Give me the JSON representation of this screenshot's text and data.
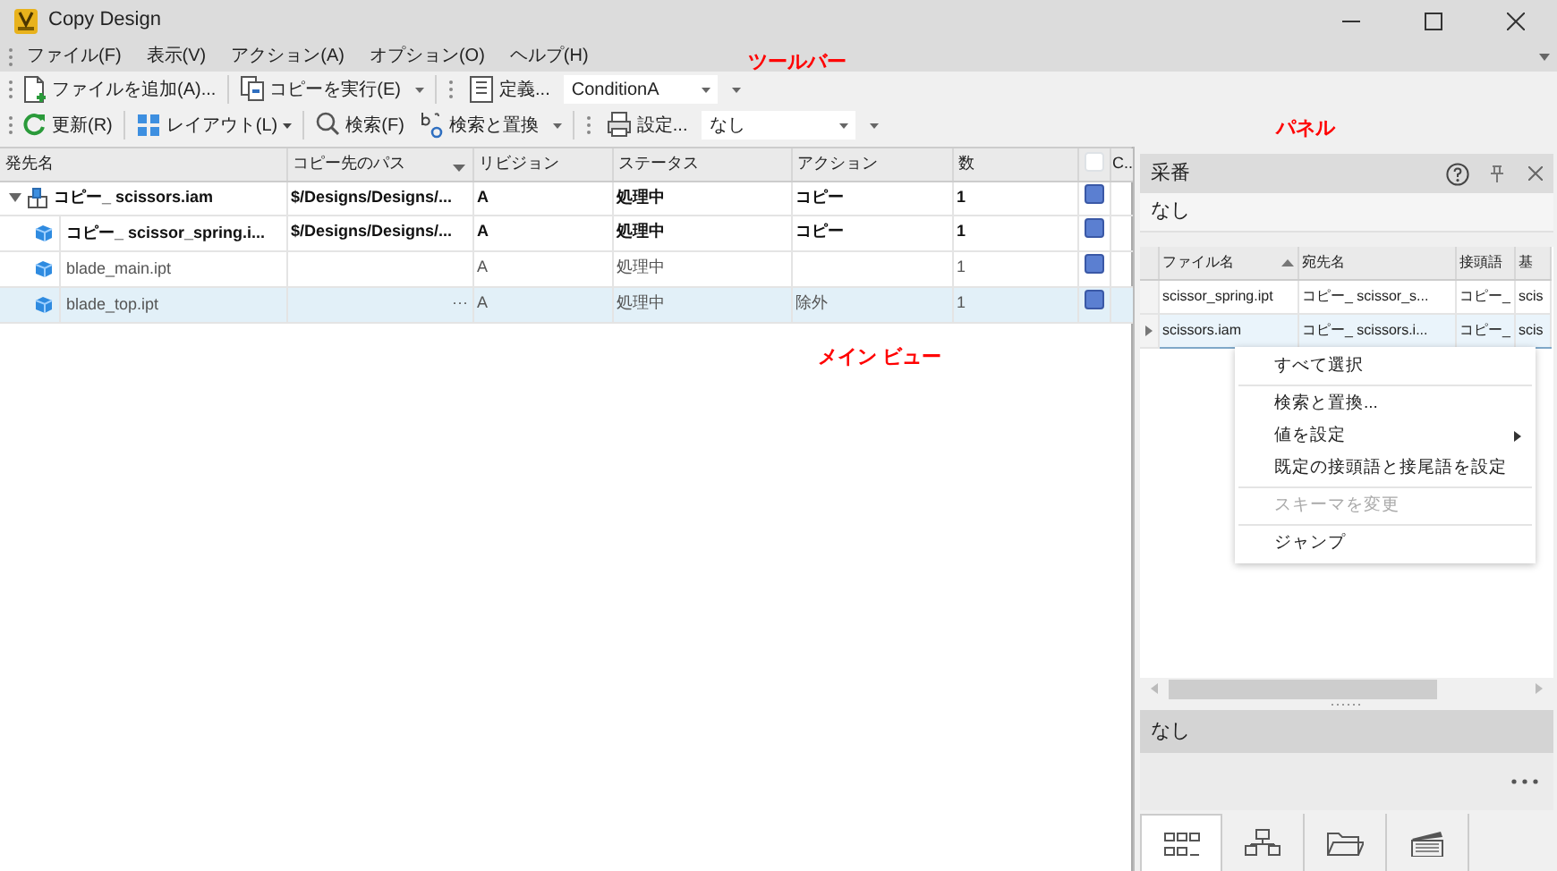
{
  "window": {
    "title": "Copy Design"
  },
  "menu": [
    "ファイル(F)",
    "表示(V)",
    "アクション(A)",
    "オプション(O)",
    "ヘルプ(H)"
  ],
  "toolbars": [
    [
      {
        "kind": "button",
        "label": "ファイルを追加(A)..."
      },
      {
        "kind": "separator"
      },
      {
        "kind": "split-button",
        "label": "コピーを実行(E)"
      },
      {
        "kind": "grip"
      },
      {
        "kind": "button",
        "label": "定義..."
      },
      {
        "kind": "combo",
        "value": "ConditionA"
      }
    ],
    [
      {
        "kind": "button",
        "label": "更新(R)"
      },
      {
        "kind": "separator"
      },
      {
        "kind": "menu-button",
        "label": "レイアウト(L)"
      },
      {
        "kind": "separator"
      },
      {
        "kind": "button",
        "label": "検索(F)"
      },
      {
        "kind": "split-button",
        "label": "検索と置換"
      },
      {
        "kind": "grip"
      },
      {
        "kind": "button",
        "label": "設定..."
      },
      {
        "kind": "combo",
        "value": "なし"
      }
    ]
  ],
  "annotations": [
    {
      "text": "ツールバー",
      "color": "#ff0000"
    },
    {
      "text": "パネル",
      "color": "#ff0000"
    },
    {
      "text": "メイン ビュー",
      "color": "#ff0000"
    }
  ],
  "main_view": {
    "columns": [
      {
        "label": "発先名",
        "filter": false
      },
      {
        "label": "コピー先のパス",
        "filter": true
      },
      {
        "label": "リビジョン",
        "filter": false
      },
      {
        "label": "ステータス",
        "filter": false
      },
      {
        "label": "アクション",
        "filter": false
      },
      {
        "label": "数",
        "filter": false
      },
      {
        "kind": "checkbox",
        "checked": false
      },
      {
        "label": "C..",
        "filter": false
      }
    ],
    "rows": [
      {
        "kind": "assembly",
        "name": "コピー_ scissors.iam",
        "path": "$/Designs/Designs/...",
        "revision": "A",
        "status": "処理中",
        "action": "コピー",
        "count": "1",
        "bold": true,
        "color": "#5b7fd1",
        "expanded": true,
        "selected": false,
        "children": [
          {
            "kind": "part",
            "name": "コピー_ scissor_spring.i...",
            "path": "$/Designs/Designs/...",
            "revision": "A",
            "status": "処理中",
            "action": "コピー",
            "count": "1",
            "bold": true,
            "color": "#5b7fd1",
            "selected": false
          },
          {
            "kind": "part",
            "name": "blade_main.ipt",
            "revision": "A",
            "status": "処理中",
            "count": "1",
            "bold": false,
            "color": "#5b7fd1",
            "selected": false
          },
          {
            "kind": "part",
            "name": "blade_top.ipt",
            "path_button": "···",
            "revision": "A",
            "status": "処理中",
            "action": "除外",
            "count": "1",
            "bold": false,
            "color": "#5b7fd1",
            "selected": true
          }
        ]
      }
    ]
  },
  "panel": {
    "title": "采番",
    "filter": "なし",
    "columns": [
      {
        "label": "ファイル名",
        "sorted": true
      },
      {
        "label": "宛先名",
        "sorted": false
      },
      {
        "label": "接頭語",
        "sorted": false
      },
      {
        "label": "基",
        "sorted": false
      }
    ],
    "rows": [
      {
        "cells": [
          "scissor_spring.ipt",
          "コピー_ scissor_s...",
          "コピー_",
          "scis"
        ],
        "selected": false
      },
      {
        "cells": [
          "scissors.iam",
          "コピー_ scissors.i...",
          "コピー_",
          "scis"
        ],
        "selected": true
      }
    ],
    "context_menu": [
      {
        "label": "すべて選択",
        "disabled": false,
        "submenu": false
      },
      {
        "kind": "separator"
      },
      {
        "label": "検索と置換...",
        "disabled": false,
        "submenu": false
      },
      {
        "label": "値を設定",
        "disabled": false,
        "submenu": true
      },
      {
        "label": "既定の接頭語と接尾語を設定",
        "disabled": false,
        "submenu": false
      },
      {
        "kind": "separator"
      },
      {
        "label": "スキーマを変更",
        "disabled": true,
        "submenu": false
      },
      {
        "kind": "separator"
      },
      {
        "label": "ジャンプ",
        "disabled": false,
        "submenu": false
      }
    ],
    "status": "なし",
    "tabs": [
      {
        "selected": true
      },
      {
        "selected": false
      },
      {
        "selected": false
      },
      {
        "selected": false
      }
    ]
  }
}
